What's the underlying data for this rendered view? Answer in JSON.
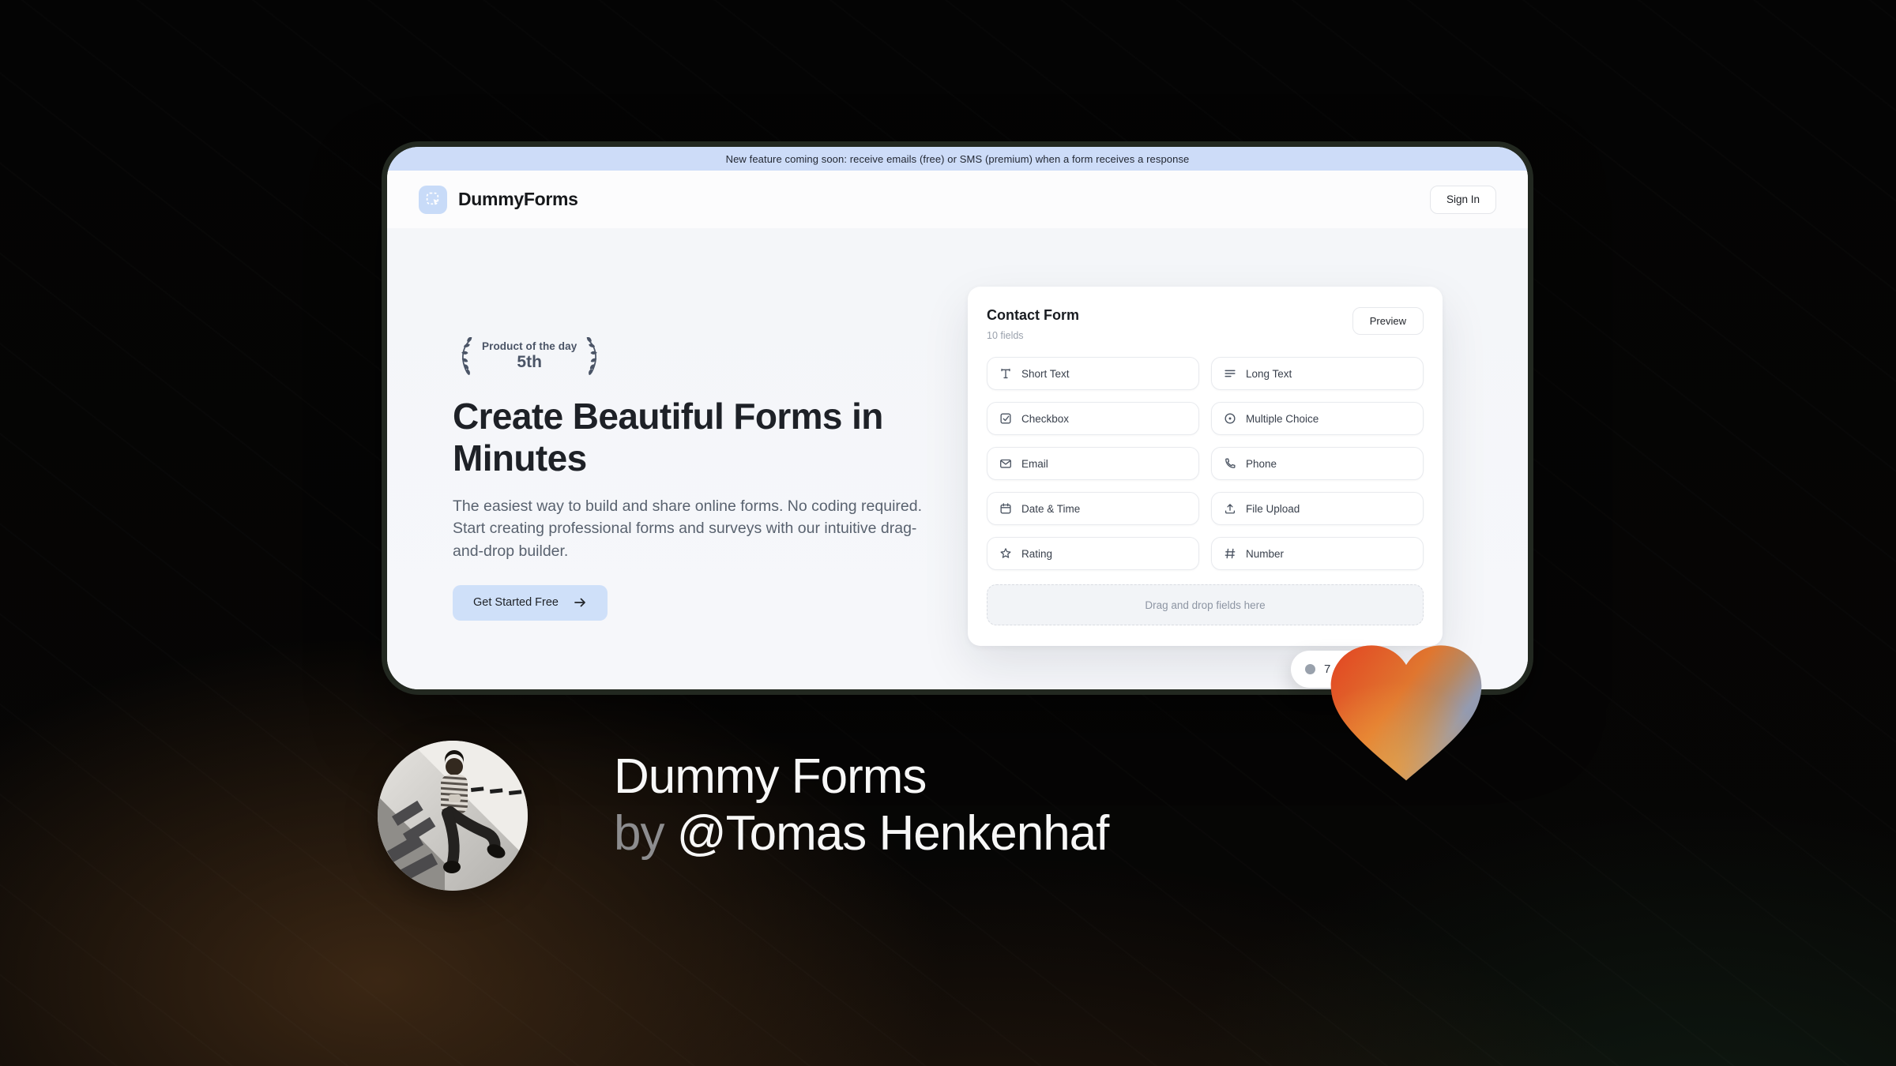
{
  "banner": {
    "text": "New feature coming soon: receive emails (free) or SMS (premium) when a form receives a response"
  },
  "header": {
    "brand": "DummyForms",
    "logo_icon": "dashed-selection-cursor-icon",
    "sign_in_label": "Sign In"
  },
  "hero": {
    "award_title": "Product of the day",
    "award_rank": "5th",
    "title": "Create Beautiful Forms in Minutes",
    "description": "The easiest way to build and share online forms. No coding required. Start creating professional forms and surveys with our intuitive drag-and-drop builder.",
    "cta_label": "Get Started Free",
    "cta_arrow_icon": "arrow-right-icon"
  },
  "form_builder": {
    "title": "Contact Form",
    "subtitle": "10 fields",
    "preview_label": "Preview",
    "fields": [
      {
        "icon": "short-text-icon",
        "label": "Short Text"
      },
      {
        "icon": "long-text-icon",
        "label": "Long Text"
      },
      {
        "icon": "checkbox-icon",
        "label": "Checkbox"
      },
      {
        "icon": "multiple-choice-icon",
        "label": "Multiple Choice"
      },
      {
        "icon": "email-icon",
        "label": "Email"
      },
      {
        "icon": "phone-icon",
        "label": "Phone"
      },
      {
        "icon": "datetime-icon",
        "label": "Date & Time"
      },
      {
        "icon": "file-upload-icon",
        "label": "File Upload"
      },
      {
        "icon": "rating-icon",
        "label": "Rating"
      },
      {
        "icon": "number-icon",
        "label": "Number"
      }
    ],
    "dropzone_text": "Drag and drop fields here",
    "counter": "7"
  },
  "footer": {
    "product_name": "Dummy Forms",
    "by_prefix": "by ",
    "author": "@Tomas Henkenhaf"
  },
  "colors": {
    "banner_bg": "#cddcf8",
    "accent_blue": "#cfe0f9",
    "logo_bg": "#c8dbf8",
    "heart_orange": "#e2512a",
    "heart_slate": "#8e96ae",
    "laurel": "#4a5466"
  }
}
